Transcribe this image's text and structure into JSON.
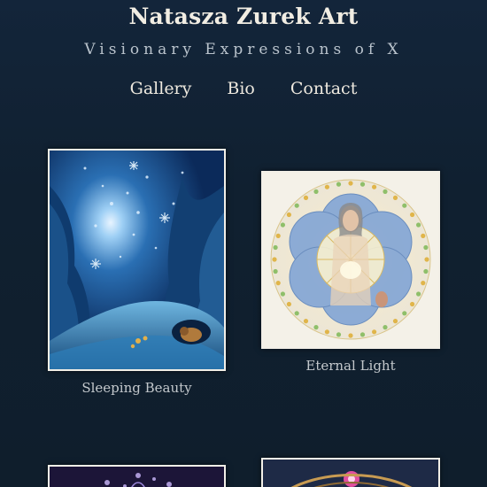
{
  "header": {
    "title": "Natasza Zurek Art",
    "tagline": "Visionary Expressions of X"
  },
  "nav": {
    "items": [
      {
        "label": "Gallery"
      },
      {
        "label": "Bio"
      },
      {
        "label": "Contact"
      }
    ]
  },
  "gallery": {
    "artworks": [
      {
        "title": "Sleeping Beauty"
      },
      {
        "title": "Eternal Light"
      }
    ]
  },
  "colors": {
    "background": "#11212f",
    "text": "#e9e5db",
    "frame": "#f2efe7"
  }
}
